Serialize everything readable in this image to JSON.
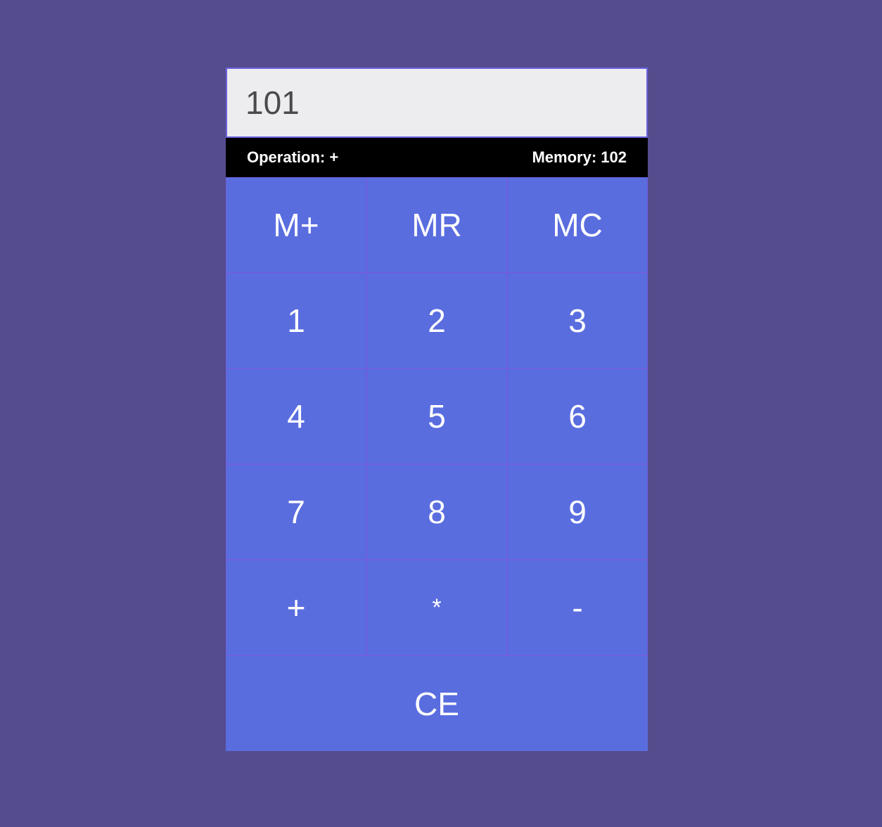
{
  "display": {
    "value": "101"
  },
  "status": {
    "operation_label": "Operation: +",
    "memory_label": "Memory: 102"
  },
  "keys": {
    "mplus": "M+",
    "mr": "MR",
    "mc": "MC",
    "d1": "1",
    "d2": "2",
    "d3": "3",
    "d4": "4",
    "d5": "5",
    "d6": "6",
    "d7": "7",
    "d8": "8",
    "d9": "9",
    "plus": "+",
    "multiply": "*",
    "minus": "-",
    "ce": "CE"
  },
  "colors": {
    "page_background": "#554c8e",
    "display_background": "#ededf0",
    "status_background": "#000000",
    "key_background": "#5a6ddf",
    "key_border": "#6e5fe0",
    "key_text": "#ffffff"
  }
}
